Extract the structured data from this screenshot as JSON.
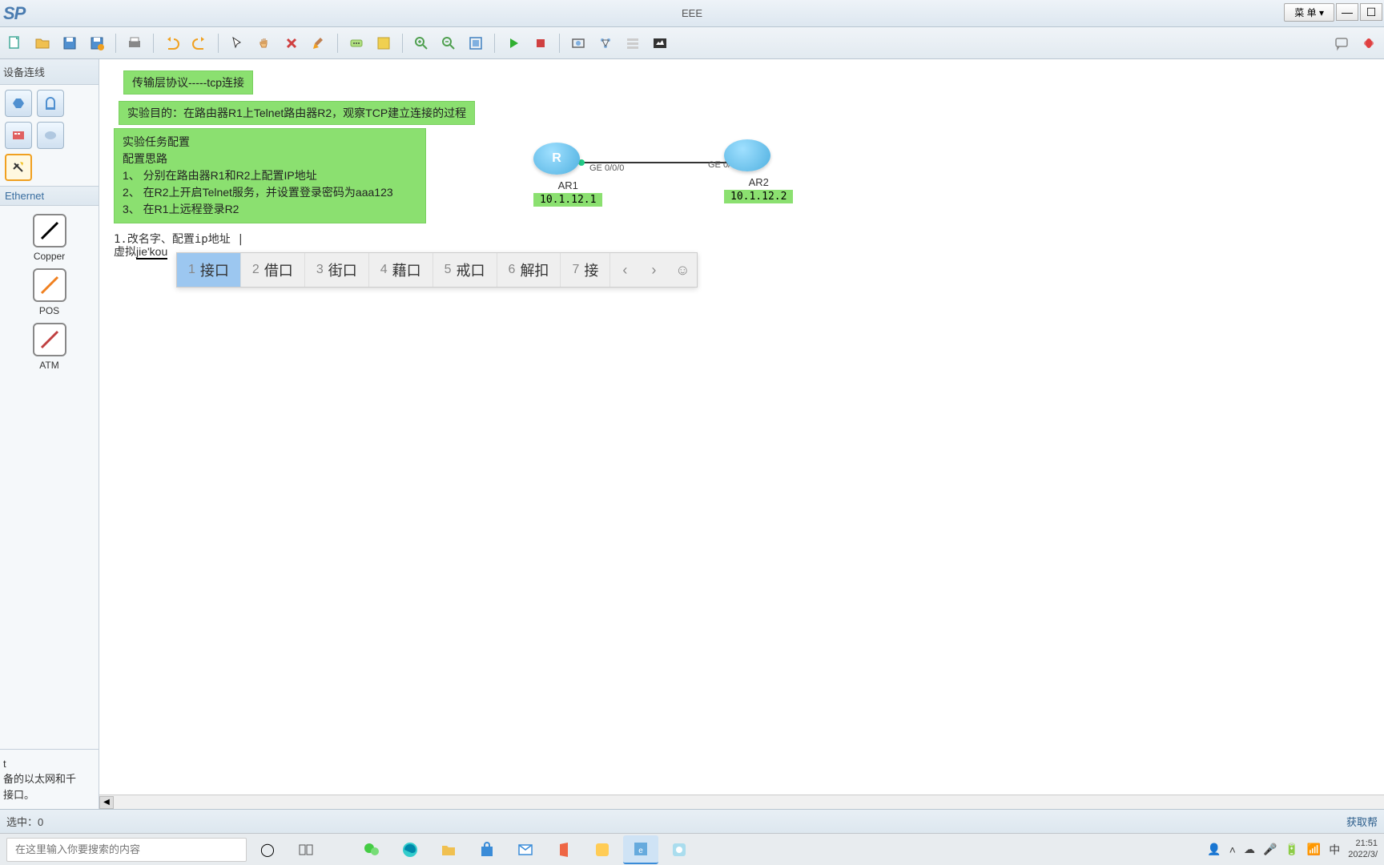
{
  "window": {
    "logo": "SP",
    "title": "EEE",
    "menu_label": "菜 单",
    "minimize": "—"
  },
  "sidebar": {
    "header": "设备连线",
    "category": "Ethernet",
    "connections": [
      {
        "label": "Copper"
      },
      {
        "label": "POS"
      },
      {
        "label": "ATM"
      }
    ],
    "desc_title": "t",
    "desc_body": "备的以太网和千\n接口。"
  },
  "canvas": {
    "note1": "传输层协议-----tcp连接",
    "note2": "实验目的：在路由器R1上Telnet路由器R2，观察TCP建立连接的过程",
    "note3": "实验任务配置\n配置思路\n1、\t分别在路由器R1和R2上配置IP地址\n2、\t在R2上开启Telnet服务，并设置登录密码为aaa123\n3、\t在R1上远程登录R2",
    "text1": "1.改名字、配置ip地址 |",
    "text2": "虚拟jie'kou",
    "router1": {
      "name": "AR1",
      "ip": "10.1.12.1",
      "letter": "R"
    },
    "router2": {
      "name": "AR2",
      "ip": "10.1.12.2",
      "letter": ""
    },
    "link": {
      "left": "GE 0/0/0",
      "right": "GE 0/0/0"
    }
  },
  "ime": {
    "candidates": [
      {
        "n": "1",
        "t": "接口"
      },
      {
        "n": "2",
        "t": "借口"
      },
      {
        "n": "3",
        "t": "街口"
      },
      {
        "n": "4",
        "t": "藉口"
      },
      {
        "n": "5",
        "t": "戒口"
      },
      {
        "n": "6",
        "t": "解扣"
      },
      {
        "n": "7",
        "t": "接"
      }
    ]
  },
  "statusbar": {
    "left": "选中：0",
    "right": "获取帮"
  },
  "taskbar": {
    "search_placeholder": "在这里输入你要搜索的内容",
    "clock_time": "21:51",
    "clock_date": "2022/3/",
    "ime_lang": "中"
  }
}
